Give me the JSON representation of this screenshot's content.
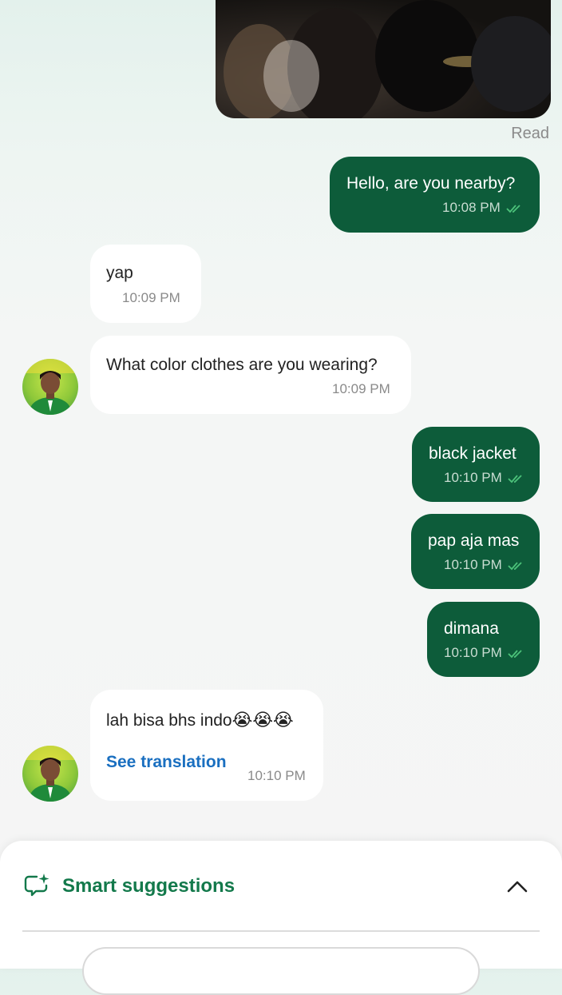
{
  "status_read": "Read",
  "messages": [
    {
      "direction": "out",
      "text": "Hello, are you nearby?",
      "time": "10:08 PM",
      "status": "read"
    },
    {
      "direction": "in",
      "text": "yap",
      "time": "10:09 PM"
    },
    {
      "direction": "in",
      "text": "What color clothes are you wearing?",
      "time": "10:09 PM"
    },
    {
      "direction": "out",
      "text": "black jacket",
      "time": "10:10 PM",
      "status": "read"
    },
    {
      "direction": "out",
      "text": "pap aja mas",
      "time": "10:10 PM",
      "status": "read"
    },
    {
      "direction": "out",
      "text": "dimana",
      "time": "10:10 PM",
      "status": "read"
    },
    {
      "direction": "in",
      "text": "lah bisa bhs indo",
      "emoji": "😭😭😭",
      "action": "See translation",
      "time": "10:10 PM"
    }
  ],
  "smart_suggestions": {
    "title": "Smart suggestions",
    "icon": "sparkle-chat-icon",
    "toggle_icon": "chevron-up-icon"
  },
  "colors": {
    "outgoing_bubble": "#0d5c3a",
    "incoming_bubble": "#ffffff",
    "accent_green": "#13794b",
    "link_blue": "#1a6fc0",
    "read_check": "#4cc27a"
  }
}
